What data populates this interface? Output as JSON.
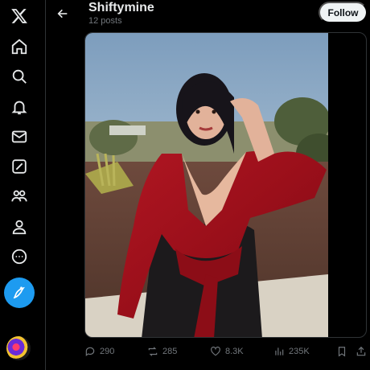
{
  "profile": {
    "name": "Shiftymine",
    "posts_count": "12 posts",
    "follow_label": "Follow"
  },
  "nav": {
    "items": [
      "x-logo-icon",
      "home-icon",
      "search-icon",
      "notifications-icon",
      "messages-icon",
      "grok-icon",
      "communities-icon",
      "profile-icon",
      "more-icon"
    ],
    "post_button": "compose-icon"
  },
  "actions": {
    "replies": "290",
    "reposts": "285",
    "likes": "8.3K",
    "views": "235K"
  },
  "colors": {
    "accent": "#1d9bf0",
    "background": "#000000",
    "muted": "#71767b"
  }
}
